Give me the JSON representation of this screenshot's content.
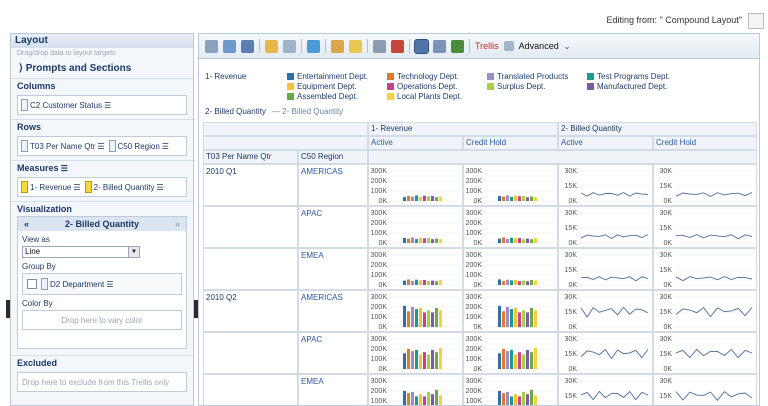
{
  "top": {
    "editing_text": "Editing from: \" Compound Layout\""
  },
  "layout": {
    "title": "Layout",
    "hint": "Drag/drop data to layout targets",
    "prompts_label": "Prompts and Sections",
    "columns_label": "Columns",
    "columns_chip": "C2 Customer Status",
    "rows_label": "Rows",
    "rows_chips": [
      "T03 Per Name Qtr",
      "C50 Region"
    ],
    "measures_label": "Measures",
    "measures_chips": [
      "1- Revenue",
      "2- Billed Quantity"
    ],
    "visualization_label": "Visualization",
    "viz_measure": "2- Billed Quantity",
    "view_as_label": "View as",
    "view_as_value": "Line",
    "group_by_label": "Group By",
    "group_by_chip": "D2 Department",
    "color_by_label": "Color By",
    "color_by_hint": "Drop here to vary color",
    "excluded_label": "Excluded",
    "excluded_hint": "Drop here to exclude from this Trellis only"
  },
  "toolbar": {
    "trellis_label": "Trellis",
    "advanced_label": "Advanced"
  },
  "legend": {
    "measure1": "1- Revenue",
    "items": [
      {
        "label": "Entertainment Dept.",
        "color": "#2f6fa6"
      },
      {
        "label": "Technology Dept.",
        "color": "#e07b2e"
      },
      {
        "label": "Translated Products",
        "color": "#9b8ec4"
      },
      {
        "label": "Test Programs Dept.",
        "color": "#1a9a8e"
      },
      {
        "label": "Equipment Dept.",
        "color": "#f5c23e"
      },
      {
        "label": "Operations Dept.",
        "color": "#c5418a"
      },
      {
        "label": "Surplus Dept.",
        "color": "#a8cf4a"
      },
      {
        "label": "Manufactured Dept.",
        "color": "#7d5aa6"
      },
      {
        "label": "Assembled Dept.",
        "color": "#6aa84f"
      },
      {
        "label": "Local Plants Dept.",
        "color": "#f6d23a"
      }
    ],
    "measure2": "2- Billed Quantity",
    "measure2_line": "2- Billed Quantity"
  },
  "grid": {
    "col_header_1": [
      "1- Revenue",
      "2- Billed Quantity"
    ],
    "col_header_2": [
      "Active",
      "Credit Hold",
      "Active",
      "Credit Hold"
    ],
    "row_header_labels": [
      "T03 Per Name Qtr",
      "C50 Region"
    ],
    "rows": [
      {
        "qtr": "2010 Q1",
        "region": "AMERICAS"
      },
      {
        "qtr": "",
        "region": "APAC"
      },
      {
        "qtr": "",
        "region": "EMEA"
      },
      {
        "qtr": "2010 Q2",
        "region": "AMERICAS"
      },
      {
        "qtr": "",
        "region": "APAC"
      },
      {
        "qtr": "",
        "region": "EMEA"
      }
    ],
    "bar_axis_ticks": [
      "300K",
      "200K",
      "100K",
      "0K"
    ],
    "line_axis_ticks": [
      "30K",
      "15K",
      "0K"
    ]
  }
}
